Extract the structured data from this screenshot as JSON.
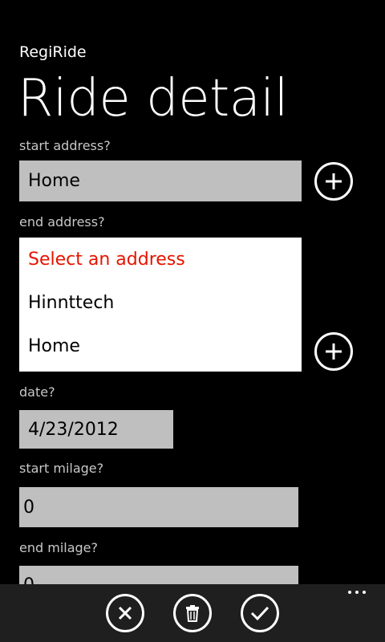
{
  "header": {
    "app_title": "RegiRide",
    "page_title": "Ride detail"
  },
  "form": {
    "start_address": {
      "label": "start address?",
      "value": "Home"
    },
    "end_address": {
      "label": "end address?",
      "options": [
        "Select an address",
        "Hinnttech",
        "Home"
      ]
    },
    "date": {
      "label": "date?",
      "value": "4/23/2012"
    },
    "start_milage": {
      "label": "start milage?",
      "value": "0"
    },
    "end_milage": {
      "label": "end milage?",
      "value": "0"
    }
  },
  "colors": {
    "background": "#000000",
    "textbox": "#bfbfbf",
    "placeholder_accent": "#e51400",
    "appbar": "#1f1f1f"
  },
  "icons": {
    "add_start": "plus-circle-icon",
    "add_end": "plus-circle-icon",
    "cancel": "close-icon",
    "delete": "trash-icon",
    "save": "check-icon",
    "more": "ellipsis-icon"
  }
}
